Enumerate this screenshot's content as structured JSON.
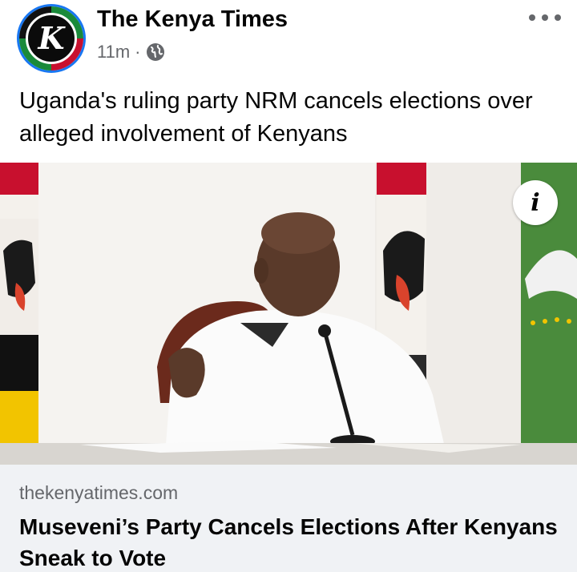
{
  "post": {
    "page_name": "The Kenya Times",
    "avatar_letter": "K",
    "time": "11m",
    "separator": "·",
    "privacy_icon": "globe-icon",
    "more_icon": "more-horizontal-icon",
    "text": "Uganda's ruling party NRM cancels elections over alleged involvement of Kenyans"
  },
  "link_preview": {
    "info_icon": "info-icon",
    "info_glyph": "i",
    "domain": "thekenyatimes.com",
    "title": "Museveni’s Party Cancels Elections After Kenyans Sneak to Vote"
  },
  "colors": {
    "accent": "#1877f2",
    "secondary_text": "#65676b",
    "footer_bg": "#f0f2f5"
  }
}
